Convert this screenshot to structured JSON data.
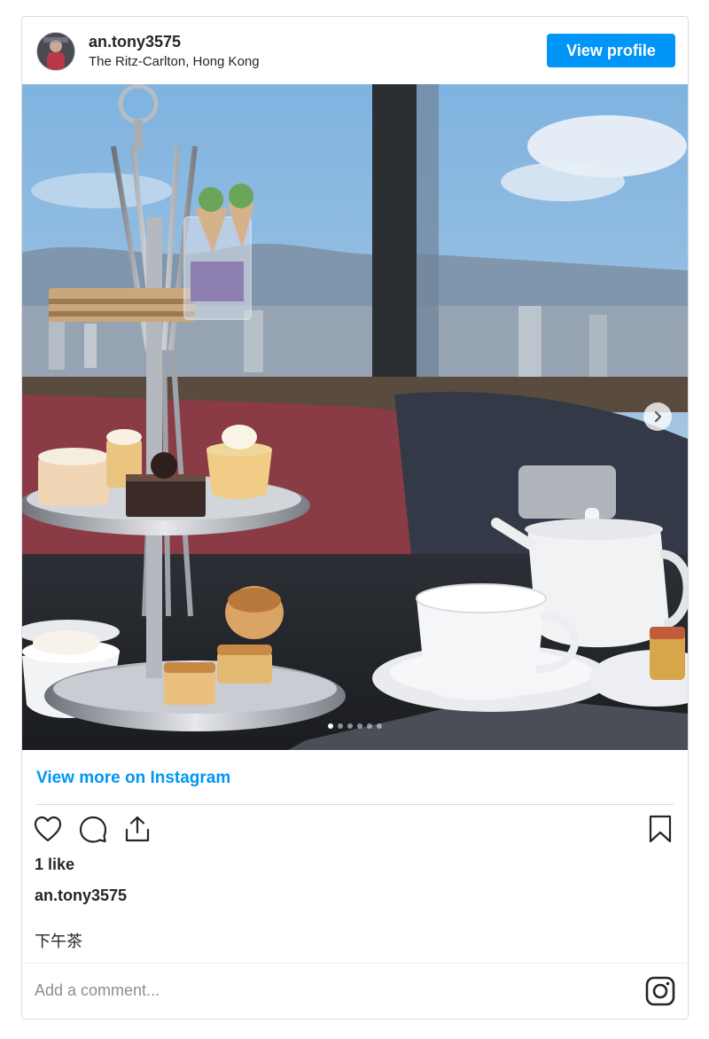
{
  "post": {
    "username": "an.tony3575",
    "location": "The Ritz-Carlton, Hong Kong",
    "view_profile_label": "View profile",
    "view_more_label": "View more on Instagram",
    "likes": "1 like",
    "caption_user": "an.tony3575",
    "caption_text": "下午茶",
    "comment_placeholder": "Add a comment...",
    "carousel": {
      "slide_count": 6,
      "active_slide": 1
    }
  },
  "icons": {
    "like": "heart-icon",
    "comment": "comment-icon",
    "share": "share-icon",
    "save": "bookmark-icon",
    "next": "chevron-right-icon",
    "brand": "instagram-icon"
  },
  "colors": {
    "accent": "#0095f6",
    "text": "#262626",
    "muted": "#8e8e8e",
    "border": "#dbdbdb"
  }
}
